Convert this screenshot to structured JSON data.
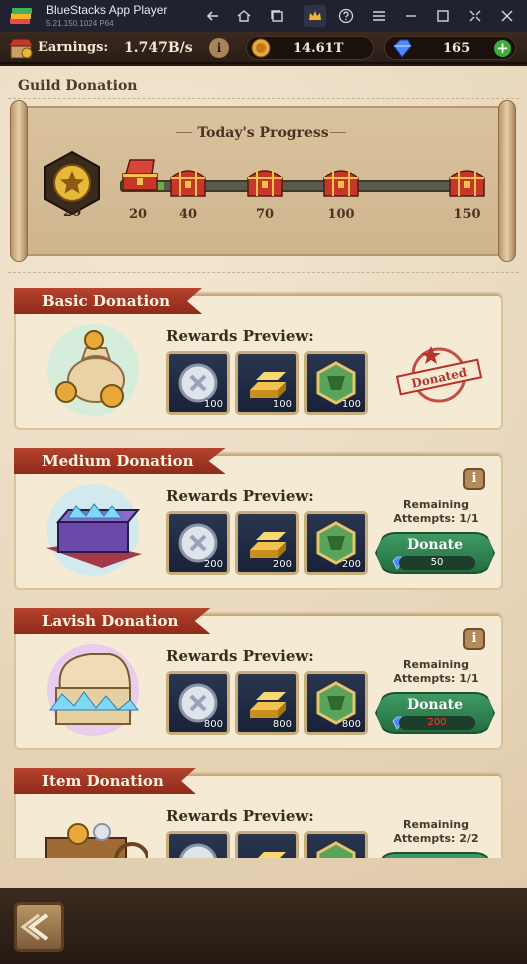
{
  "window": {
    "app_title": "BlueStacks App Player",
    "version": "5.21.150.1024  P64",
    "icons": [
      "back-arrow-icon",
      "home-icon",
      "multi-instance-icon",
      "crown-icon",
      "help-icon",
      "menu-icon",
      "minimize-icon",
      "maximize-icon",
      "restore-icon",
      "close-icon"
    ]
  },
  "topbar": {
    "earnings_label": "Earnings:",
    "earnings_value": "1.747B/s",
    "coins_value": "14.61T",
    "gems_value": "165"
  },
  "page": {
    "title": "Guild Donation"
  },
  "progress": {
    "title": "Today's Progress",
    "current_value": "20",
    "current_fill_fraction": 0.12,
    "milestones": [
      "20",
      "40",
      "70",
      "100",
      "150"
    ]
  },
  "cards": [
    {
      "title": "Basic Donation",
      "rewards_label": "Rewards Preview:",
      "rewards": [
        "100",
        "100",
        "100"
      ],
      "status": "Donated"
    },
    {
      "title": "Medium Donation",
      "rewards_label": "Rewards Preview:",
      "rewards": [
        "200",
        "200",
        "200"
      ],
      "remaining_label": "Remaining",
      "attempts_label": "Attempts: 1/1",
      "donate_label": "Donate",
      "cost": "50"
    },
    {
      "title": "Lavish Donation",
      "rewards_label": "Rewards Preview:",
      "rewards": [
        "800",
        "800",
        "800"
      ],
      "remaining_label": "Remaining",
      "attempts_label": "Attempts: 1/1",
      "donate_label": "Donate",
      "cost": "200",
      "cost_color": "#ff3b30"
    },
    {
      "title": "Item Donation",
      "rewards_label": "Rewards Preview:",
      "remaining_label": "Remaining",
      "attempts_label": "Attempts: 2/2"
    }
  ],
  "colors": {
    "ribbon": "#a23a25",
    "donate_button": "#2f8553",
    "progress_fill": "#6bab3c"
  }
}
